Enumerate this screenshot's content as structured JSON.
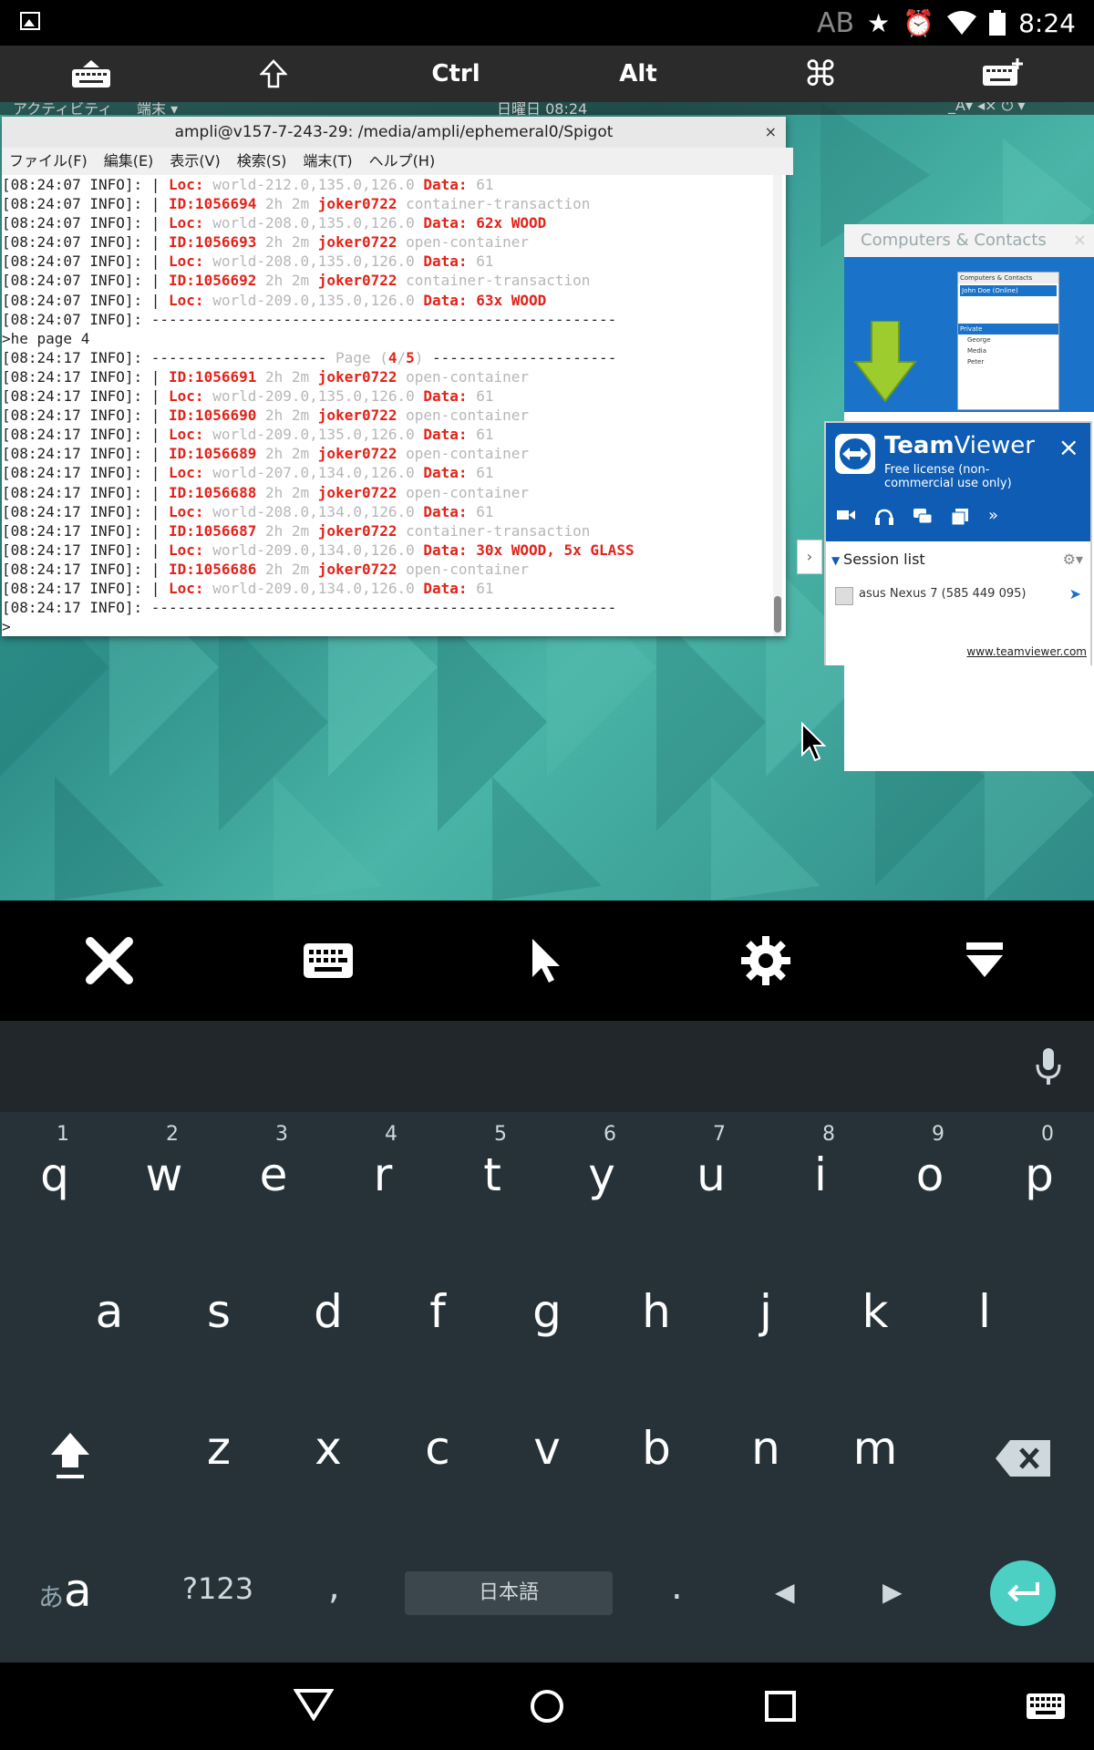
{
  "status_bar": {
    "indicator": "AB",
    "time": "8:24",
    "icons": [
      "image-notification-icon",
      "star-icon",
      "alarm-icon",
      "wifi-icon",
      "battery-icon"
    ]
  },
  "modifier_bar": {
    "keys": [
      "keyboard-icon",
      "shift-icon",
      "Ctrl",
      "Alt",
      "command-icon",
      "keyboard-plus-icon"
    ],
    "ctrl": "Ctrl",
    "alt": "Alt"
  },
  "gnome_bar": {
    "activities": "アクティビティ",
    "app": "端末 ▾",
    "clock": "日曜日 08:24",
    "right": "_A▾   ◂×  ⏻ ▾"
  },
  "terminal": {
    "title": "ampli@v157-7-243-29: /media/ampli/ephemeral0/Spigot",
    "close": "×",
    "menu": [
      "ファイル(F)",
      "編集(E)",
      "表示(V)",
      "検索(S)",
      "端末(T)",
      "ヘルプ(H)"
    ],
    "lines": [
      [
        [
          "[08:24:07 INFO]: | ",
          ""
        ],
        [
          "Loc: ",
          "red"
        ],
        [
          "world-212.0,135.0,126.0 ",
          "gray"
        ],
        [
          "Data: ",
          "red"
        ],
        [
          "61",
          "gray"
        ]
      ],
      [
        [
          "[08:24:07 INFO]: | ",
          ""
        ],
        [
          "ID:1056694 ",
          "red"
        ],
        [
          "2h 2m ",
          "gray"
        ],
        [
          "joker0722 ",
          "red"
        ],
        [
          "container-transaction",
          "gray"
        ]
      ],
      [
        [
          "[08:24:07 INFO]: | ",
          ""
        ],
        [
          "Loc: ",
          "red"
        ],
        [
          "world-208.0,135.0,126.0 ",
          "gray"
        ],
        [
          "Data: 62x WOOD",
          "red"
        ]
      ],
      [
        [
          "[08:24:07 INFO]: | ",
          ""
        ],
        [
          "ID:1056693 ",
          "red"
        ],
        [
          "2h 2m ",
          "gray"
        ],
        [
          "joker0722 ",
          "red"
        ],
        [
          "open-container",
          "gray"
        ]
      ],
      [
        [
          "[08:24:07 INFO]: | ",
          ""
        ],
        [
          "Loc: ",
          "red"
        ],
        [
          "world-208.0,135.0,126.0 ",
          "gray"
        ],
        [
          "Data: ",
          "red"
        ],
        [
          "61",
          "gray"
        ]
      ],
      [
        [
          "[08:24:07 INFO]: | ",
          ""
        ],
        [
          "ID:1056692 ",
          "red"
        ],
        [
          "2h 2m ",
          "gray"
        ],
        [
          "joker0722 ",
          "red"
        ],
        [
          "container-transaction",
          "gray"
        ]
      ],
      [
        [
          "[08:24:07 INFO]: | ",
          ""
        ],
        [
          "Loc: ",
          "red"
        ],
        [
          "world-209.0,135.0,126.0 ",
          "gray"
        ],
        [
          "Data: 63x WOOD",
          "red"
        ]
      ],
      [
        [
          "[08:24:07 INFO]: -----------------------------------------------------",
          ""
        ]
      ],
      [
        [
          ">he page 4",
          ""
        ]
      ],
      [
        [
          "[08:24:17 INFO]: -------------------- ",
          ""
        ],
        [
          "Page (",
          "gray"
        ],
        [
          "4",
          "red"
        ],
        [
          "/",
          "gray"
        ],
        [
          "5",
          "red"
        ],
        [
          ") ",
          "gray"
        ],
        [
          "---------------------",
          ""
        ]
      ],
      [
        [
          "[08:24:17 INFO]: | ",
          ""
        ],
        [
          "ID:1056691 ",
          "red"
        ],
        [
          "2h 2m ",
          "gray"
        ],
        [
          "joker0722 ",
          "red"
        ],
        [
          "open-container",
          "gray"
        ]
      ],
      [
        [
          "[08:24:17 INFO]: | ",
          ""
        ],
        [
          "Loc: ",
          "red"
        ],
        [
          "world-209.0,135.0,126.0 ",
          "gray"
        ],
        [
          "Data: ",
          "red"
        ],
        [
          "61",
          "gray"
        ]
      ],
      [
        [
          "[08:24:17 INFO]: | ",
          ""
        ],
        [
          "ID:1056690 ",
          "red"
        ],
        [
          "2h 2m ",
          "gray"
        ],
        [
          "joker0722 ",
          "red"
        ],
        [
          "open-container",
          "gray"
        ]
      ],
      [
        [
          "[08:24:17 INFO]: | ",
          ""
        ],
        [
          "Loc: ",
          "red"
        ],
        [
          "world-209.0,135.0,126.0 ",
          "gray"
        ],
        [
          "Data: ",
          "red"
        ],
        [
          "61",
          "gray"
        ]
      ],
      [
        [
          "[08:24:17 INFO]: | ",
          ""
        ],
        [
          "ID:1056689 ",
          "red"
        ],
        [
          "2h 2m ",
          "gray"
        ],
        [
          "joker0722 ",
          "red"
        ],
        [
          "open-container",
          "gray"
        ]
      ],
      [
        [
          "[08:24:17 INFO]: | ",
          ""
        ],
        [
          "Loc: ",
          "red"
        ],
        [
          "world-207.0,134.0,126.0 ",
          "gray"
        ],
        [
          "Data: ",
          "red"
        ],
        [
          "61",
          "gray"
        ]
      ],
      [
        [
          "[08:24:17 INFO]: | ",
          ""
        ],
        [
          "ID:1056688 ",
          "red"
        ],
        [
          "2h 2m ",
          "gray"
        ],
        [
          "joker0722 ",
          "red"
        ],
        [
          "open-container",
          "gray"
        ]
      ],
      [
        [
          "[08:24:17 INFO]: | ",
          ""
        ],
        [
          "Loc: ",
          "red"
        ],
        [
          "world-208.0,134.0,126.0 ",
          "gray"
        ],
        [
          "Data: ",
          "red"
        ],
        [
          "61",
          "gray"
        ]
      ],
      [
        [
          "[08:24:17 INFO]: | ",
          ""
        ],
        [
          "ID:1056687 ",
          "red"
        ],
        [
          "2h 2m ",
          "gray"
        ],
        [
          "joker0722 ",
          "red"
        ],
        [
          "container-transaction",
          "gray"
        ]
      ],
      [
        [
          "[08:24:17 INFO]: | ",
          ""
        ],
        [
          "Loc: ",
          "red"
        ],
        [
          "world-209.0,134.0,126.0 ",
          "gray"
        ],
        [
          "Data: 30x WOOD, 5x GLASS",
          "red"
        ]
      ],
      [
        [
          "[08:24:17 INFO]: | ",
          ""
        ],
        [
          "ID:1056686 ",
          "red"
        ],
        [
          "2h 2m ",
          "gray"
        ],
        [
          "joker0722 ",
          "red"
        ],
        [
          "open-container",
          "gray"
        ]
      ],
      [
        [
          "[08:24:17 INFO]: | ",
          ""
        ],
        [
          "Loc: ",
          "red"
        ],
        [
          "world-209.0,134.0,126.0 ",
          "gray"
        ],
        [
          "Data: ",
          "red"
        ],
        [
          "61",
          "gray"
        ]
      ],
      [
        [
          "[08:24:17 INFO]: -----------------------------------------------------",
          ""
        ]
      ],
      [
        [
          ">",
          ""
        ]
      ]
    ]
  },
  "computers_contacts": {
    "title": "Computers & Contacts",
    "close": "×",
    "mini_title": "Computers & Contacts",
    "mini_user": "John Doe (Online)",
    "mini_group": "Private",
    "mini_items": [
      "George",
      "Media",
      "Peter"
    ]
  },
  "teamviewer": {
    "brand_bold": "Team",
    "brand_light": "Viewer",
    "license": "Free license (non-commercial use only)",
    "close": "×",
    "session_list": "Session list",
    "session_item": "asus Nexus 7 (585 449 095)",
    "link": "www.teamviewer.com"
  },
  "remote_toolbar": [
    "close-icon",
    "keyboard-icon",
    "pointer-icon",
    "gear-icon",
    "hide-toolbar-icon"
  ],
  "keyboard": {
    "row1": [
      "q",
      "w",
      "e",
      "r",
      "t",
      "y",
      "u",
      "i",
      "o",
      "p"
    ],
    "row1_hints": [
      "1",
      "2",
      "3",
      "4",
      "5",
      "6",
      "7",
      "8",
      "9",
      "0"
    ],
    "row2": [
      "a",
      "s",
      "d",
      "f",
      "g",
      "h",
      "j",
      "k",
      "l"
    ],
    "row3": [
      "z",
      "x",
      "c",
      "v",
      "b",
      "n",
      "m"
    ],
    "lang_switch_kana": "あ",
    "lang_switch_latin": "a",
    "symbols": "?123",
    "comma": ",",
    "space": "日本語",
    "period": ".",
    "left": "◀",
    "right": "▶"
  },
  "nav_bar": [
    "back-icon",
    "home-icon",
    "recents-icon",
    "keyboard-switch-icon"
  ]
}
